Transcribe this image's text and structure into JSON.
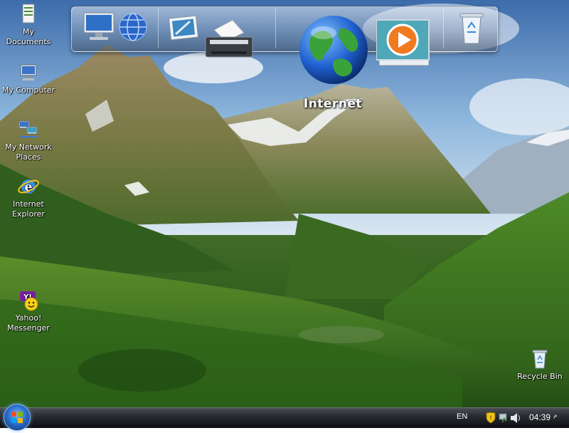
{
  "desktop": {
    "icons": [
      {
        "label": "My\nDocuments",
        "icon": "folder-documents-icon"
      },
      {
        "label": "My Computer",
        "icon": "computer-icon"
      },
      {
        "label": "My Network\nPlaces",
        "icon": "network-places-icon"
      },
      {
        "label": "Internet\nExplorer",
        "icon": "internet-explorer-icon"
      },
      {
        "label": "Yahoo!\nMessenger",
        "icon": "yahoo-messenger-icon"
      },
      {
        "label": "Recycle Bin",
        "icon": "recycle-bin-icon"
      }
    ]
  },
  "dock": {
    "items": [
      "computer-icon",
      "globe-network-icon",
      "picture-icon",
      "printer-icon",
      "internet-globe-icon",
      "media-player-icon",
      "trash-icon"
    ],
    "hover_label": "Internet"
  },
  "taskbar": {
    "language": "EN",
    "clock": "04:39",
    "clock_suffix": "م"
  },
  "colors": {
    "taskbar": "#1a1d21",
    "dock_glass": "#9aa8bb",
    "label_text": "#ffffff"
  }
}
